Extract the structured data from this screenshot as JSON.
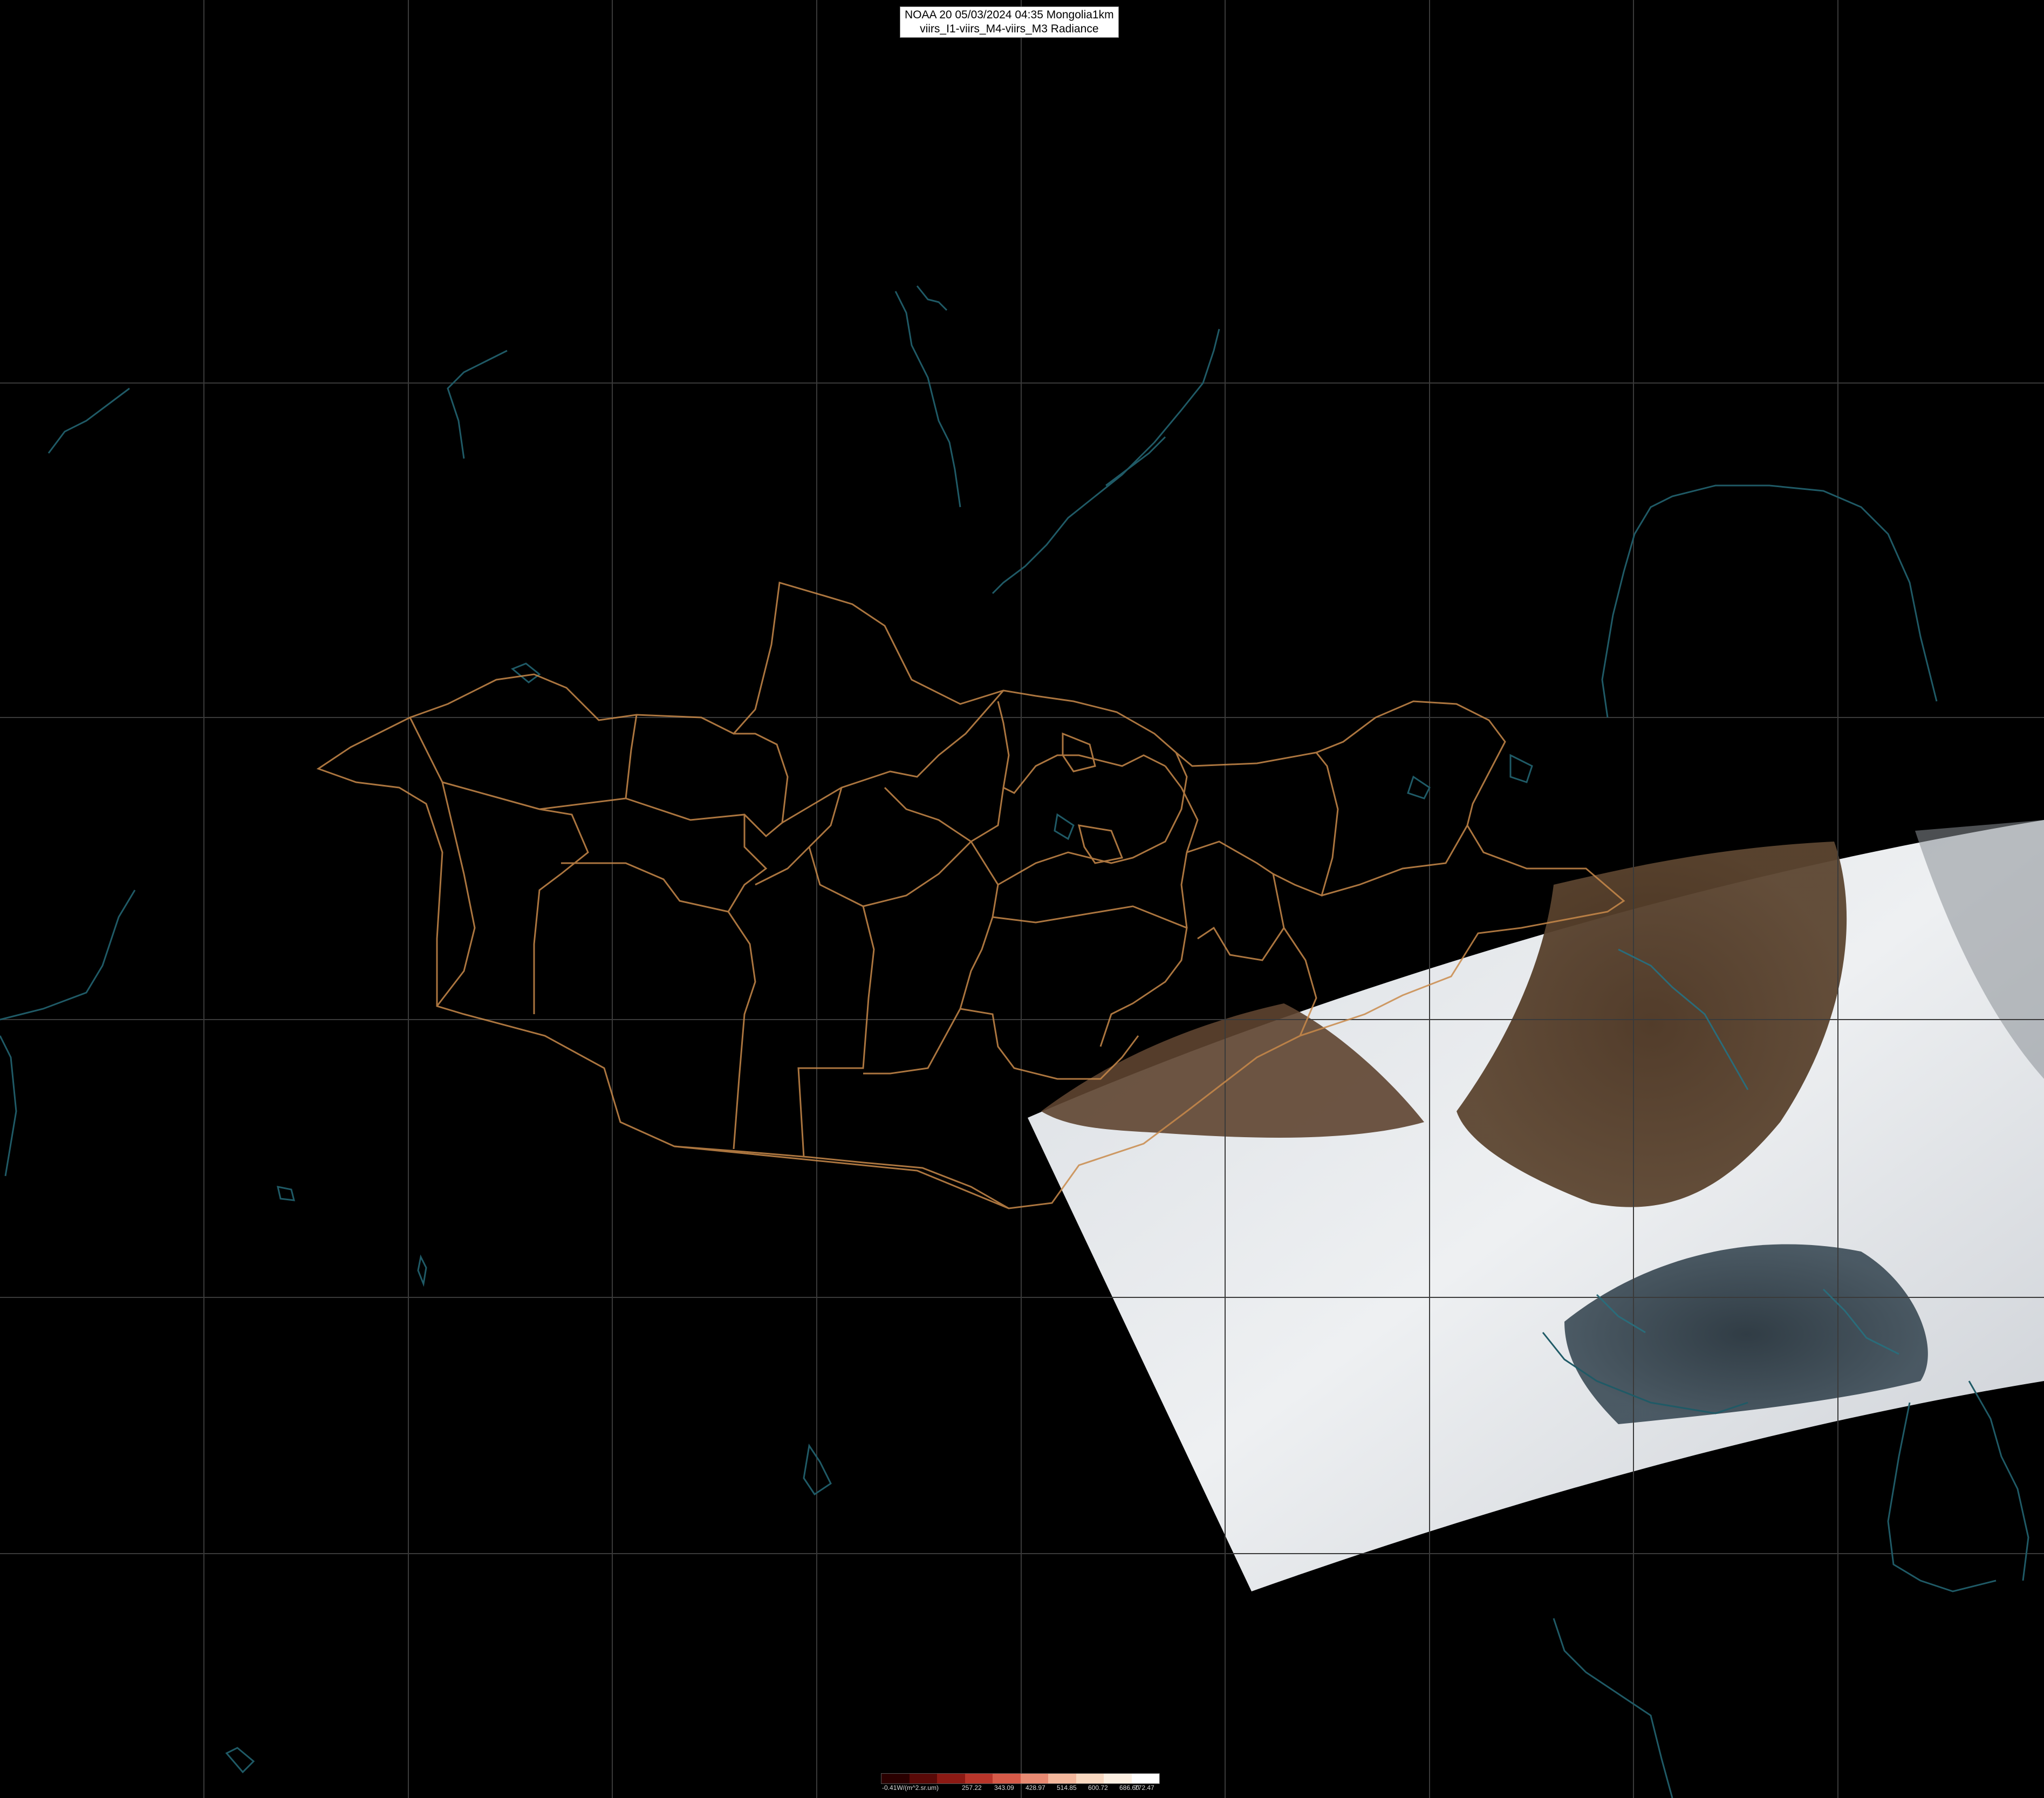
{
  "title": {
    "line1": "NOAA 20 05/03/2024 04:35 Mongolia1km",
    "line2": "viirs_I1-viirs_M4-viirs_M3 Radiance"
  },
  "colors": {
    "background": "#000000",
    "grid": "#3a3a3a",
    "coastline": "#1f5a66",
    "admin_border": "#c98a4a",
    "cloud": "#e8ecf0",
    "land": "#5a3f28"
  },
  "legend": {
    "ticks": [
      "-0.41W/(m^2.sr.um)",
      "257.22",
      "343.09",
      "428.97",
      "514.85",
      "600.72",
      "686.60",
      "772.47"
    ],
    "colors": [
      "#2a0000",
      "#5a0a08",
      "#8c1a14",
      "#b8352a",
      "#d65a48",
      "#e88a72",
      "#f3b79c",
      "#f8d8c0",
      "#fcefe2",
      "#ffffff"
    ]
  }
}
